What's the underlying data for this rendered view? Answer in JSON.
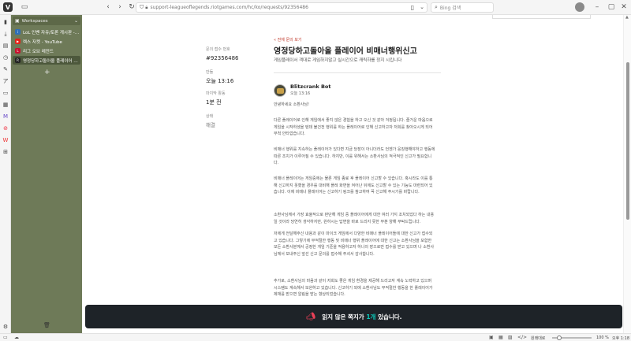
{
  "browser": {
    "logo": "V",
    "url": "support-leagueoflegends.riotgames.com/hc/ko/requests/92356486",
    "search_placeholder": "Bing 검색"
  },
  "workspace": {
    "label": "Workspaces"
  },
  "tabs": [
    {
      "label": "LoL 인벤 자유/토론 게시판 - 리그",
      "favicon_color": "#2f6fb8",
      "favicon_glyph": "i"
    },
    {
      "label": "렉스 자켓 - YouTube",
      "favicon_color": "#e62117",
      "favicon_glyph": "▶"
    },
    {
      "label": "리그 오브 레전드",
      "favicon_color": "#c8102e",
      "favicon_glyph": "L"
    },
    {
      "label": "영정당하고돌아올 플레이어 비매너",
      "favicon_color": "#222222",
      "favicon_glyph": "R"
    }
  ],
  "request": {
    "meta": {
      "id_label": "문의 접수 번호",
      "id_value": "#92356486",
      "created_label": "만듦",
      "created_value": "오늘 13:16",
      "activity_label": "마지막 활동",
      "activity_value": "1분 전",
      "status_label": "상태",
      "status_value": "해결"
    },
    "back_link": "« 전체 문의 보기",
    "title": "영정당하고돌아올 플레이어 비매너행위신고",
    "subtitle": "게임플레이서 객대로 게임하지않고 실시간으로 캐릭하를 정지 시킵니다"
  },
  "post": {
    "author": "Blitzcrank Bot",
    "time": "오늘 13:16",
    "paragraphs": [
      "안녕하세요 소환사님!",
      "다른 플레이어로 인해 게임에서 좋지 않은 경험을 하고 오신 것 같아 걱정됩니다. 즐거운 마음으로 게임을 시작하셨을 텐데 불건전 행위를 하는 플레이어로 인해 신고하고자 저희를 찾아오시게 되어 무척 안타깝습니다.",
      "비매너 행위를 지속하는 플레이어가 있다면 지금 당장이 아니더라도 언젠가 응징행해야하고 행동에 따른 조치가 이루어질 수 있습니다. 하지만, 이를 위해서는 소환사님의 적극적인 신고가 필요합니다.",
      "비매너 플레이어는 게임중에는 물론 게임 종료 후 플레이어 신고할 수 있습니다. 혹시라도 이를 통해 신고하지 못했을 경우를 대비해 플레 화면을 켜어난 뒤에도 신고할 수 있는 기능도 마련되어 있습니다. 이에 비매너 플레이어는 신고하기 링크를 참고하여 꼭 신고해 주시기를 바랍니다.",
      "소환사님께서 가장 효율적으로 판단해 게임 중 플레이어에게 대한 여러 가지 조치되었다 하는 내용일 것이라 당연히 생각하지만, 원하시는 답변을 바로 드리지 못한 부분 양해 부탁드립니다.",
      "저에게 전달해주신 내용과 같이 마이크 게임에서 다양한 비매너 플레이어들에 대한 신고가 접수되고 있습니다. 그렇기에 부적절한 행동 및 비매너 행위 플레이어에 대한 신고는 소환사님을 포함한 모든 소환사분께서 공정한 게임 기준을 적용하고자 하나의 장으로만 접수를 받고 있으며 나 소환사님께서 보내주신 앞선 신고 문의를 접수해 주셔서 감사합니다.",
      "추가로, 소환사님의 마음과 같이 저희도 좋은 게임 환경을 제공해 드리고자 계속 노력하고 있으며 시스템도 계속해서 보완하고 있습니다. 신고하기 외에 소환사님도 부적절한 행동을 한 플레이어가 제재를 받으면 알림을 받는 향상되었습니다."
    ]
  },
  "toast": {
    "prefix": "읽지 않은 쪽지가 ",
    "count": "1개",
    "suffix": " 있습니다."
  },
  "statusbar": {
    "zoom_label": "원래대로",
    "zoom_value": "100 %",
    "clock": "오후 1:18"
  },
  "colors": {
    "sidebar": "#6e7a58",
    "toast_bg": "#1e2328",
    "toast_highlight": "#0ac8b9",
    "accent_red": "#c0392b"
  }
}
